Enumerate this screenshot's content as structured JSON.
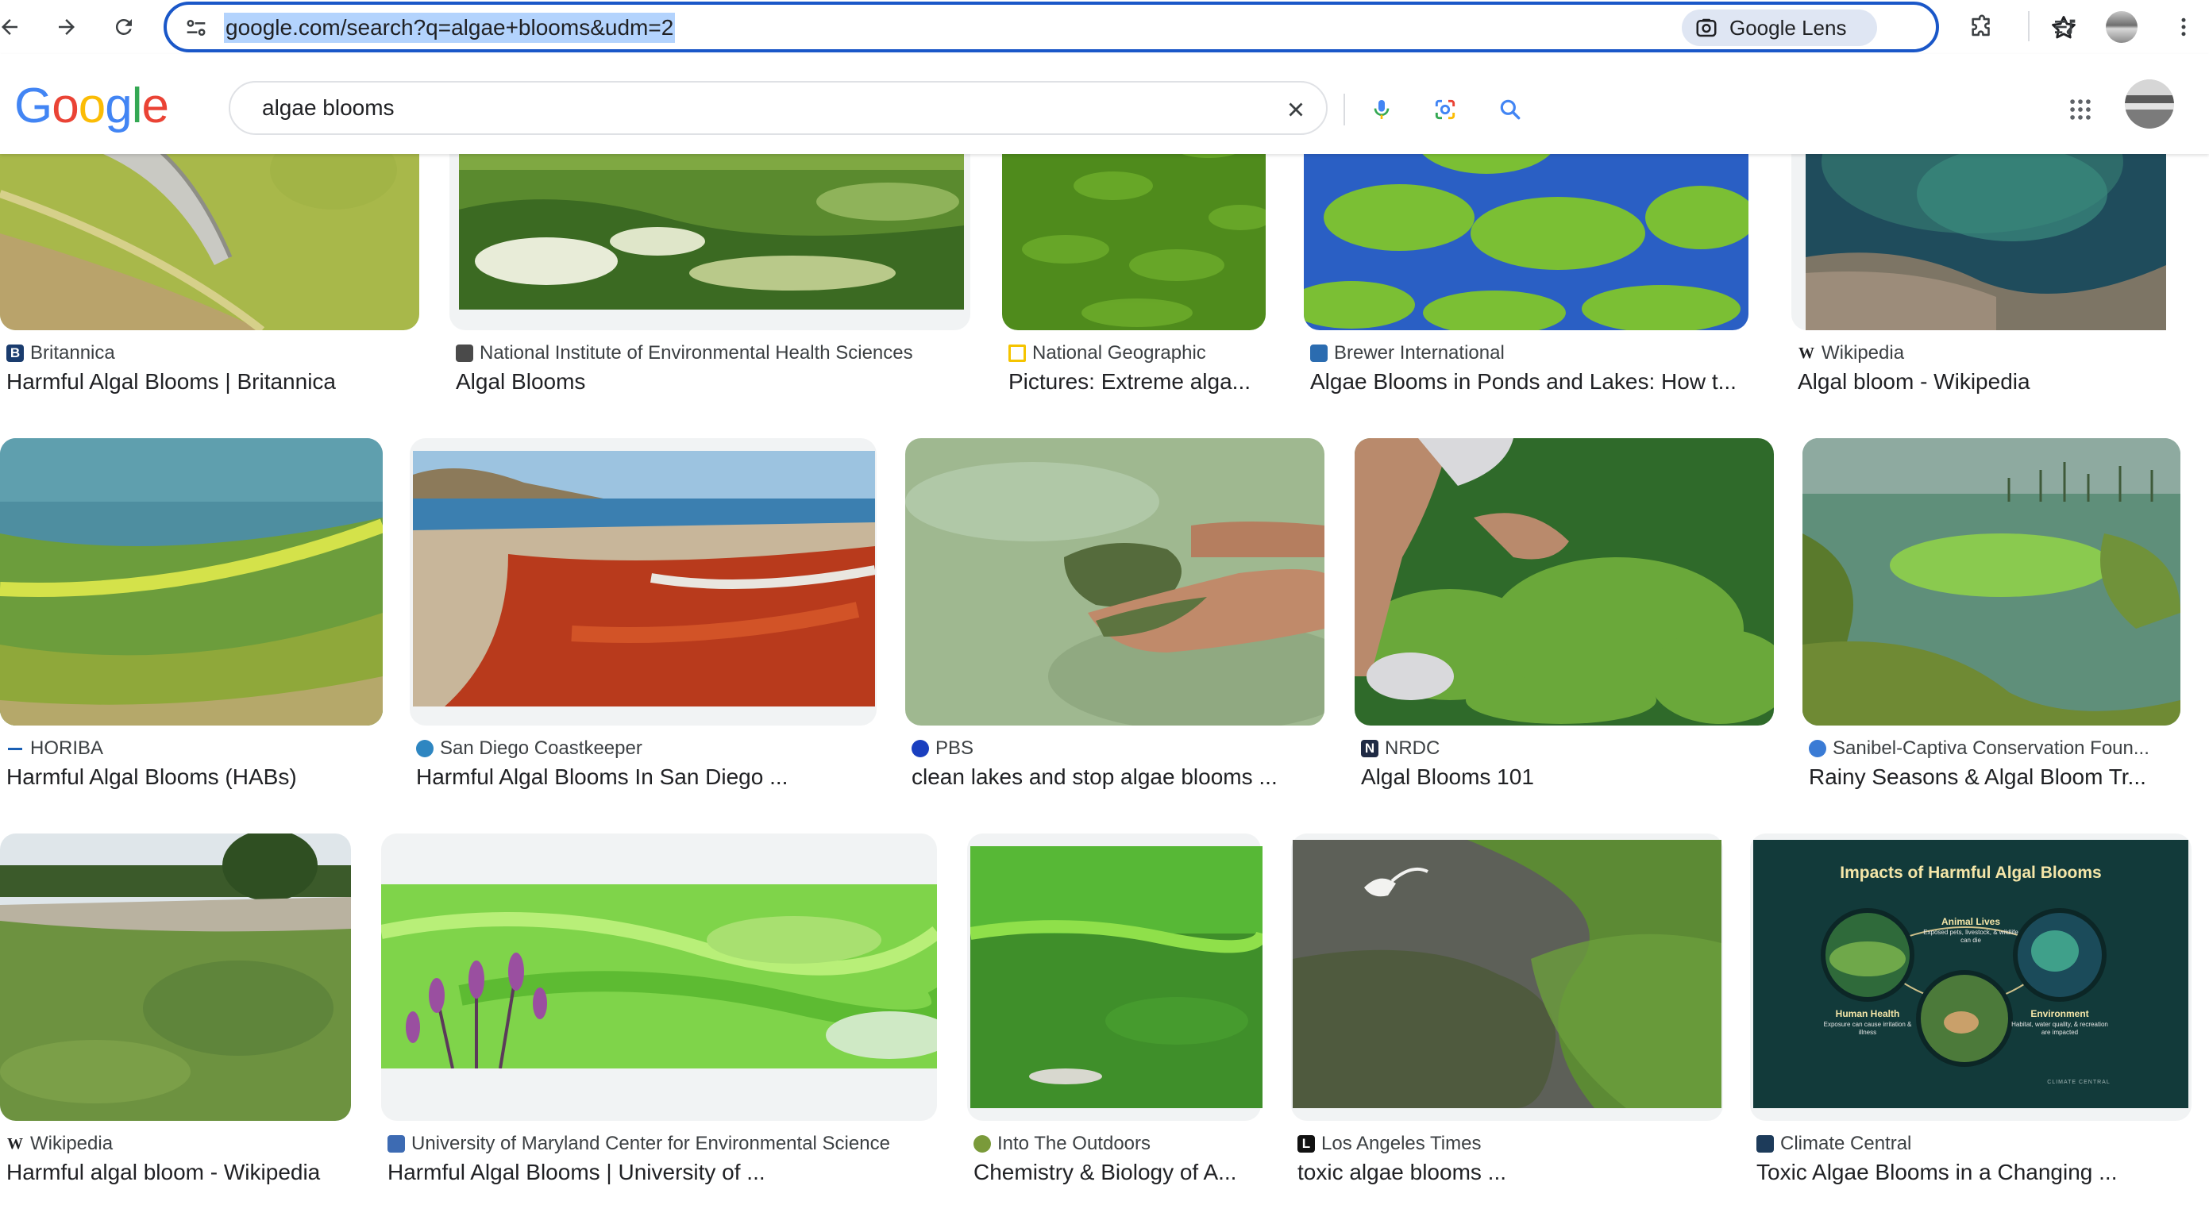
{
  "browser": {
    "url": "google.com/search?q=algae+blooms&udm=2",
    "lens_label": "Google Lens"
  },
  "google": {
    "logo_text": "Google",
    "query": "algae blooms"
  },
  "results": [
    {
      "source": "Britannica",
      "title": "Harmful Algal Blooms | Britannica",
      "favicon": "britannica-icon",
      "fav_color": "#1a3c6e"
    },
    {
      "source": "National Institute of Environmental Health Sciences",
      "title": "Algal Blooms",
      "favicon": "niehs-icon",
      "fav_color": "#4a4a4a"
    },
    {
      "source": "National Geographic",
      "title": "Pictures: Extreme alga...",
      "favicon": "natgeo-icon",
      "fav_color": "#f5c400"
    },
    {
      "source": "Brewer International",
      "title": "Algae Blooms in Ponds and Lakes: How t...",
      "favicon": "brewer-icon",
      "fav_color": "#2b6cb0"
    },
    {
      "source": "Wikipedia",
      "title": "Algal bloom - Wikipedia",
      "favicon": "wikipedia-icon",
      "fav_color": "#ffffff"
    },
    {
      "source": "HORIBA",
      "title": "Harmful Algal Blooms (HABs)",
      "favicon": "horiba-icon",
      "fav_color": "#1a5fb4"
    },
    {
      "source": "San Diego Coastkeeper",
      "title": "Harmful Algal Blooms In San Diego ...",
      "favicon": "coastkeeper-icon",
      "fav_color": "#2e86c1"
    },
    {
      "source": "PBS",
      "title": "clean lakes and stop algae blooms ...",
      "favicon": "pbs-icon",
      "fav_color": "#1a3fbf"
    },
    {
      "source": "NRDC",
      "title": "Algal Blooms 101",
      "favicon": "nrdc-icon",
      "fav_color": "#1f2a44"
    },
    {
      "source": "Sanibel-Captiva Conservation Foun...",
      "title": "Rainy Seasons & Algal Bloom Tr...",
      "favicon": "sccf-icon",
      "fav_color": "#3a7bd5"
    },
    {
      "source": "Wikipedia",
      "title": "Harmful algal bloom - Wikipedia",
      "favicon": "wikipedia-icon",
      "fav_color": "#ffffff"
    },
    {
      "source": "University of Maryland Center for Environmental Science",
      "title": "Harmful Algal Blooms | University of ...",
      "favicon": "umces-icon",
      "fav_color": "#3d6bb3"
    },
    {
      "source": "Into The Outdoors",
      "title": "Chemistry & Biology of A...",
      "favicon": "into-the-outdoors-icon",
      "fav_color": "#7a9a3a"
    },
    {
      "source": "Los Angeles Times",
      "title": "toxic algae blooms ...",
      "favicon": "latimes-icon",
      "fav_color": "#111111"
    },
    {
      "source": "Climate Central",
      "title": "Toxic Algae Blooms in a Changing ...",
      "favicon": "climate-central-icon",
      "fav_color": "#1d3b5a"
    }
  ],
  "infographic": {
    "title": "Impacts of Harmful Algal Blooms",
    "animal_label": "Animal Lives",
    "animal_sub": "Exposed pets, livestock, & wildlife can die",
    "human_label": "Human Health",
    "human_sub": "Exposure can cause irritation & illness",
    "env_label": "Environment",
    "env_sub": "Habitat, water quality, & recreation are impacted",
    "brand": "CLIMATE CENTRAL"
  }
}
